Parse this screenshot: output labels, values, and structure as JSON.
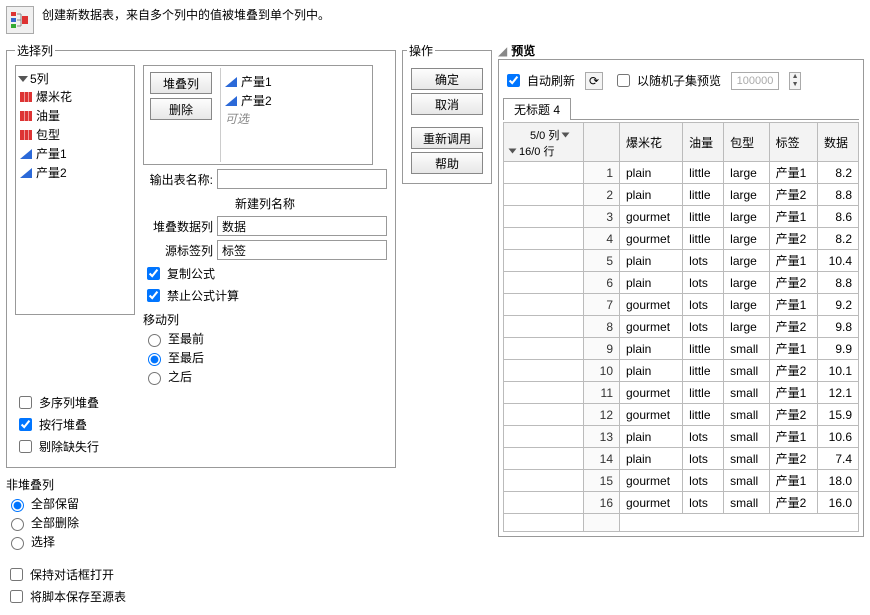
{
  "header": {
    "desc": "创建新数据表，来自多个列中的值被堆叠到单个列中。"
  },
  "select": {
    "legend": "选择列",
    "count_label": "5列",
    "items": [
      {
        "label": "爆米花",
        "kind": "red"
      },
      {
        "label": "油量",
        "kind": "red"
      },
      {
        "label": "包型",
        "kind": "red"
      },
      {
        "label": "产量1",
        "kind": "blue"
      },
      {
        "label": "产量2",
        "kind": "blue"
      }
    ],
    "stacked_btn": "堆叠列",
    "delete_btn": "删除",
    "stacked_values": [
      "产量1",
      "产量2"
    ],
    "stacked_placeholder": "可选",
    "out_table_label": "输出表名称:",
    "out_table_value": "",
    "new_col_section": "新建列名称",
    "stack_data_label": "堆叠数据列",
    "stack_data_value": "数据",
    "source_tag_label": "源标签列",
    "source_tag_value": "标签",
    "copy_formula": "复制公式",
    "forbid_calc": "禁止公式计算",
    "move_section": "移动列",
    "move_options": [
      "至最前",
      "至最后",
      "之后"
    ],
    "move_selected": "至最后",
    "multi_seq": "多序列堆叠",
    "by_row": "按行堆叠",
    "drop_missing": "剔除缺失行"
  },
  "nonstack": {
    "label": "非堆叠列",
    "options": [
      "全部保留",
      "全部删除",
      "选择"
    ],
    "selected": "全部保留"
  },
  "footer": {
    "keep_open": "保持对话框打开",
    "save_script": "将脚本保存至源表"
  },
  "actions": {
    "legend": "操作",
    "ok": "确定",
    "cancel": "取消",
    "recall": "重新调用",
    "help": "帮助"
  },
  "preview": {
    "legend": "预览",
    "auto_refresh": "自动刷新",
    "random_subset": "以随机子集预览",
    "subset_n": "100000",
    "tab": "无标题 4",
    "cols_info": "5/0 列",
    "rows_info": "16/0 行",
    "headers": [
      "爆米花",
      "油量",
      "包型",
      "标签",
      "数据"
    ],
    "rows": [
      [
        "plain",
        "little",
        "large",
        "产量1",
        "8.2"
      ],
      [
        "plain",
        "little",
        "large",
        "产量2",
        "8.8"
      ],
      [
        "gourmet",
        "little",
        "large",
        "产量1",
        "8.6"
      ],
      [
        "gourmet",
        "little",
        "large",
        "产量2",
        "8.2"
      ],
      [
        "plain",
        "lots",
        "large",
        "产量1",
        "10.4"
      ],
      [
        "plain",
        "lots",
        "large",
        "产量2",
        "8.8"
      ],
      [
        "gourmet",
        "lots",
        "large",
        "产量1",
        "9.2"
      ],
      [
        "gourmet",
        "lots",
        "large",
        "产量2",
        "9.8"
      ],
      [
        "plain",
        "little",
        "small",
        "产量1",
        "9.9"
      ],
      [
        "plain",
        "little",
        "small",
        "产量2",
        "10.1"
      ],
      [
        "gourmet",
        "little",
        "small",
        "产量1",
        "12.1"
      ],
      [
        "gourmet",
        "little",
        "small",
        "产量2",
        "15.9"
      ],
      [
        "plain",
        "lots",
        "small",
        "产量1",
        "10.6"
      ],
      [
        "plain",
        "lots",
        "small",
        "产量2",
        "7.4"
      ],
      [
        "gourmet",
        "lots",
        "small",
        "产量1",
        "18.0"
      ],
      [
        "gourmet",
        "lots",
        "small",
        "产量2",
        "16.0"
      ]
    ]
  }
}
